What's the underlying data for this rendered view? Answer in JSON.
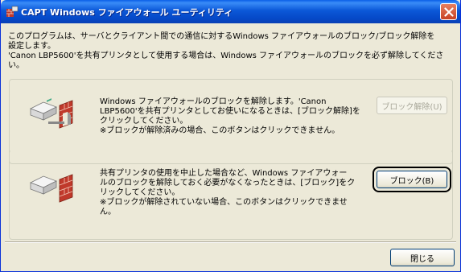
{
  "window": {
    "title": "CAPT Windows ファイアウォール ユーティリティ",
    "intro_lines": [
      "このプログラムは、サーバとクライアント間での通信に対するWindows ファイアウォールのブロック/ブロック解除を",
      "設定します。",
      "'Canon LBP5600'を共有プリンタとして使用する場合は、Windows ファイアウォールのブロックを必ず解除してくださ",
      "い。"
    ]
  },
  "unblock_section": {
    "desc_lines": [
      "Windows ファイアウォールのブロックを解除します。'Canon",
      "LBP5600'を共有プリンタとしてお使いになるときは、[ブロック解除]を",
      "クリックしてください。",
      "※ブロックが解除済みの場合、このボタンはクリックできません。"
    ],
    "button_label": "ブロック解除(U)"
  },
  "block_section": {
    "desc_lines": [
      "共有プリンタの使用を中止した場合など、Windows ファイアウォー",
      "ルのブロックを解除しておく必要がなくなったときは、[ブロック]をク",
      "リックしてください。",
      "※ブロックが解除されていない場合、このボタンはクリックできませ",
      "ん。"
    ],
    "button_label": "ブロック(B)"
  },
  "footer": {
    "close_label": "閉じる"
  }
}
